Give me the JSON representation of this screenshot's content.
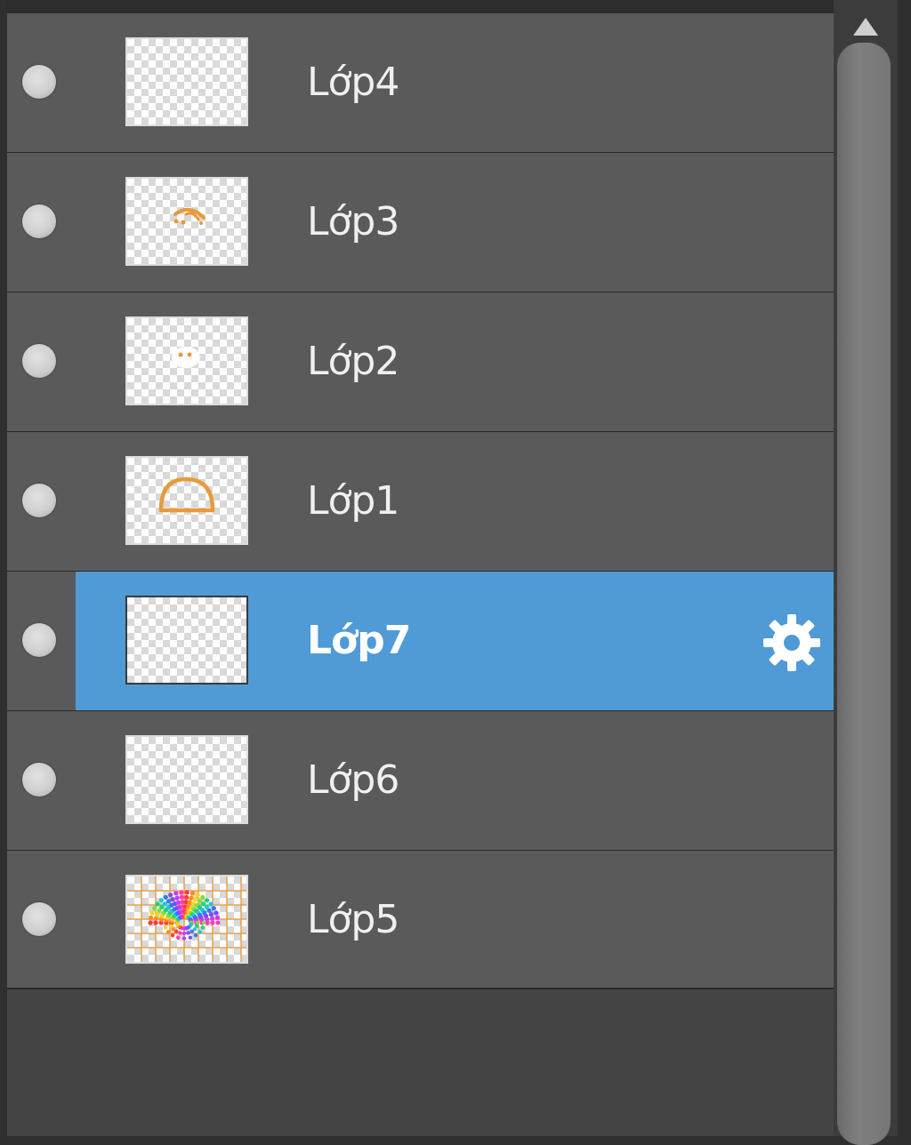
{
  "layers": [
    {
      "name": "Lớp4",
      "thumbnail": "empty",
      "selected": false,
      "visible": true
    },
    {
      "name": "Lớp3",
      "thumbnail": "orange-arc-stroke",
      "selected": false,
      "visible": true
    },
    {
      "name": "Lớp2",
      "thumbnail": "orange-dots",
      "selected": false,
      "visible": true
    },
    {
      "name": "Lớp1",
      "thumbnail": "orange-dome-outline",
      "selected": false,
      "visible": true
    },
    {
      "name": "Lớp7",
      "thumbnail": "empty",
      "selected": true,
      "visible": true
    },
    {
      "name": "Lớp6",
      "thumbnail": "empty",
      "selected": false,
      "visible": true
    },
    {
      "name": "Lớp5",
      "thumbnail": "color-wheel-grid",
      "selected": false,
      "visible": true
    }
  ],
  "icons": {
    "settings": "gear-icon",
    "scroll_up": "triangle-up-icon",
    "visibility": "visibility-dot-icon"
  },
  "colors": {
    "row_background": "#5a5a5a",
    "selected_background": "#509ad5",
    "panel_background": "#444444",
    "text": "#f0f0f0",
    "sketch_orange": "#e89a3c"
  }
}
